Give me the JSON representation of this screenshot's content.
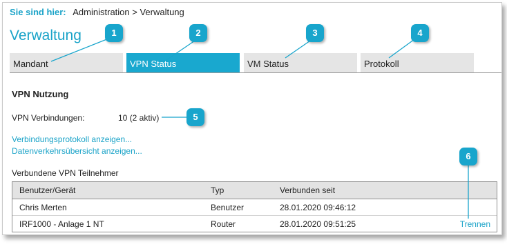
{
  "breadcrumb": {
    "label": "Sie sind hier:",
    "path": "Administration > Verwaltung"
  },
  "page_title": "Verwaltung",
  "tabs": [
    {
      "label": "Mandant"
    },
    {
      "label": "VPN Status"
    },
    {
      "label": "VM Status"
    },
    {
      "label": "Protokoll"
    }
  ],
  "section": {
    "title": "VPN Nutzung",
    "connections_label": "VPN Verbindungen:",
    "connections_value": "10 (2 aktiv)"
  },
  "links": {
    "connection_log": "Verbindungsprotokoll anzeigen...",
    "traffic_overview": "Datenverkehrsübersicht anzeigen..."
  },
  "participants": {
    "title": "Verbundene VPN Teilnehmer",
    "columns": [
      "Benutzer/Gerät",
      "Typ",
      "Verbunden seit"
    ],
    "rows": [
      {
        "device": "Chris Merten",
        "type": "Benutzer",
        "since": "28.01.2020 09:46:12",
        "action": ""
      },
      {
        "device": "IRF1000 - Anlage 1 NT",
        "type": "Router",
        "since": "28.01.2020 09:51:25",
        "action": "Trennen"
      }
    ]
  },
  "callouts": [
    "1",
    "2",
    "3",
    "4",
    "5",
    "6"
  ],
  "colors": {
    "accent": "#19a8cf",
    "tab_inactive": "#e5e5e5",
    "header_bg": "#e3e3e3"
  }
}
